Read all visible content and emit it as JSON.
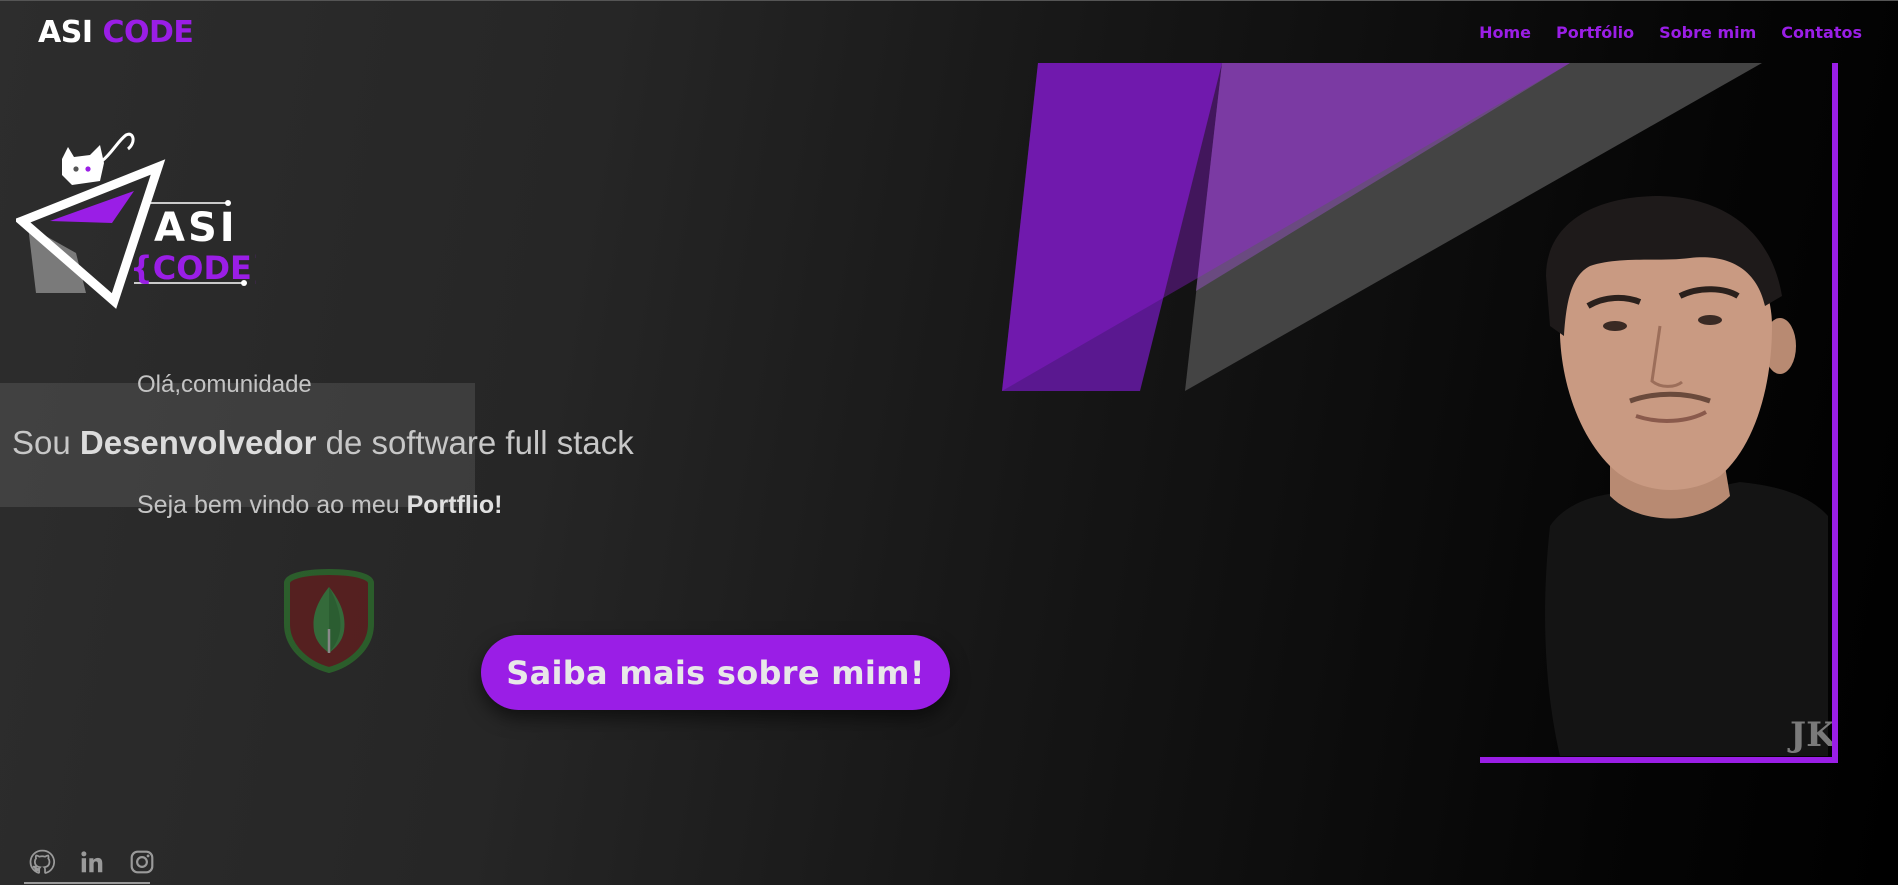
{
  "header": {
    "brand_part1": "ASI",
    "brand_part2": "CODE",
    "nav": [
      {
        "label": "Home"
      },
      {
        "label": "Portfólio"
      },
      {
        "label": "Sobre mim"
      },
      {
        "label": "Contatos"
      }
    ]
  },
  "logo": {
    "line1": "ASI",
    "line2": "{CODE}"
  },
  "hero": {
    "greeting": "Olá,comunidade",
    "headline_prefix": "Sou ",
    "headline_bold": "Desenvolvedor",
    "headline_suffix": " de software full stack",
    "welcome_prefix": "Seja bem vindo ao meu ",
    "welcome_bold": "Portflio!",
    "cta_label": "Saiba mais sobre mim!"
  },
  "photo": {
    "watermark": "JK"
  },
  "social": {
    "icons": [
      "github-icon",
      "linkedin-icon",
      "instagram-icon"
    ]
  },
  "colors": {
    "accent": "#9a1ee6",
    "background": "#2a2a2a"
  }
}
